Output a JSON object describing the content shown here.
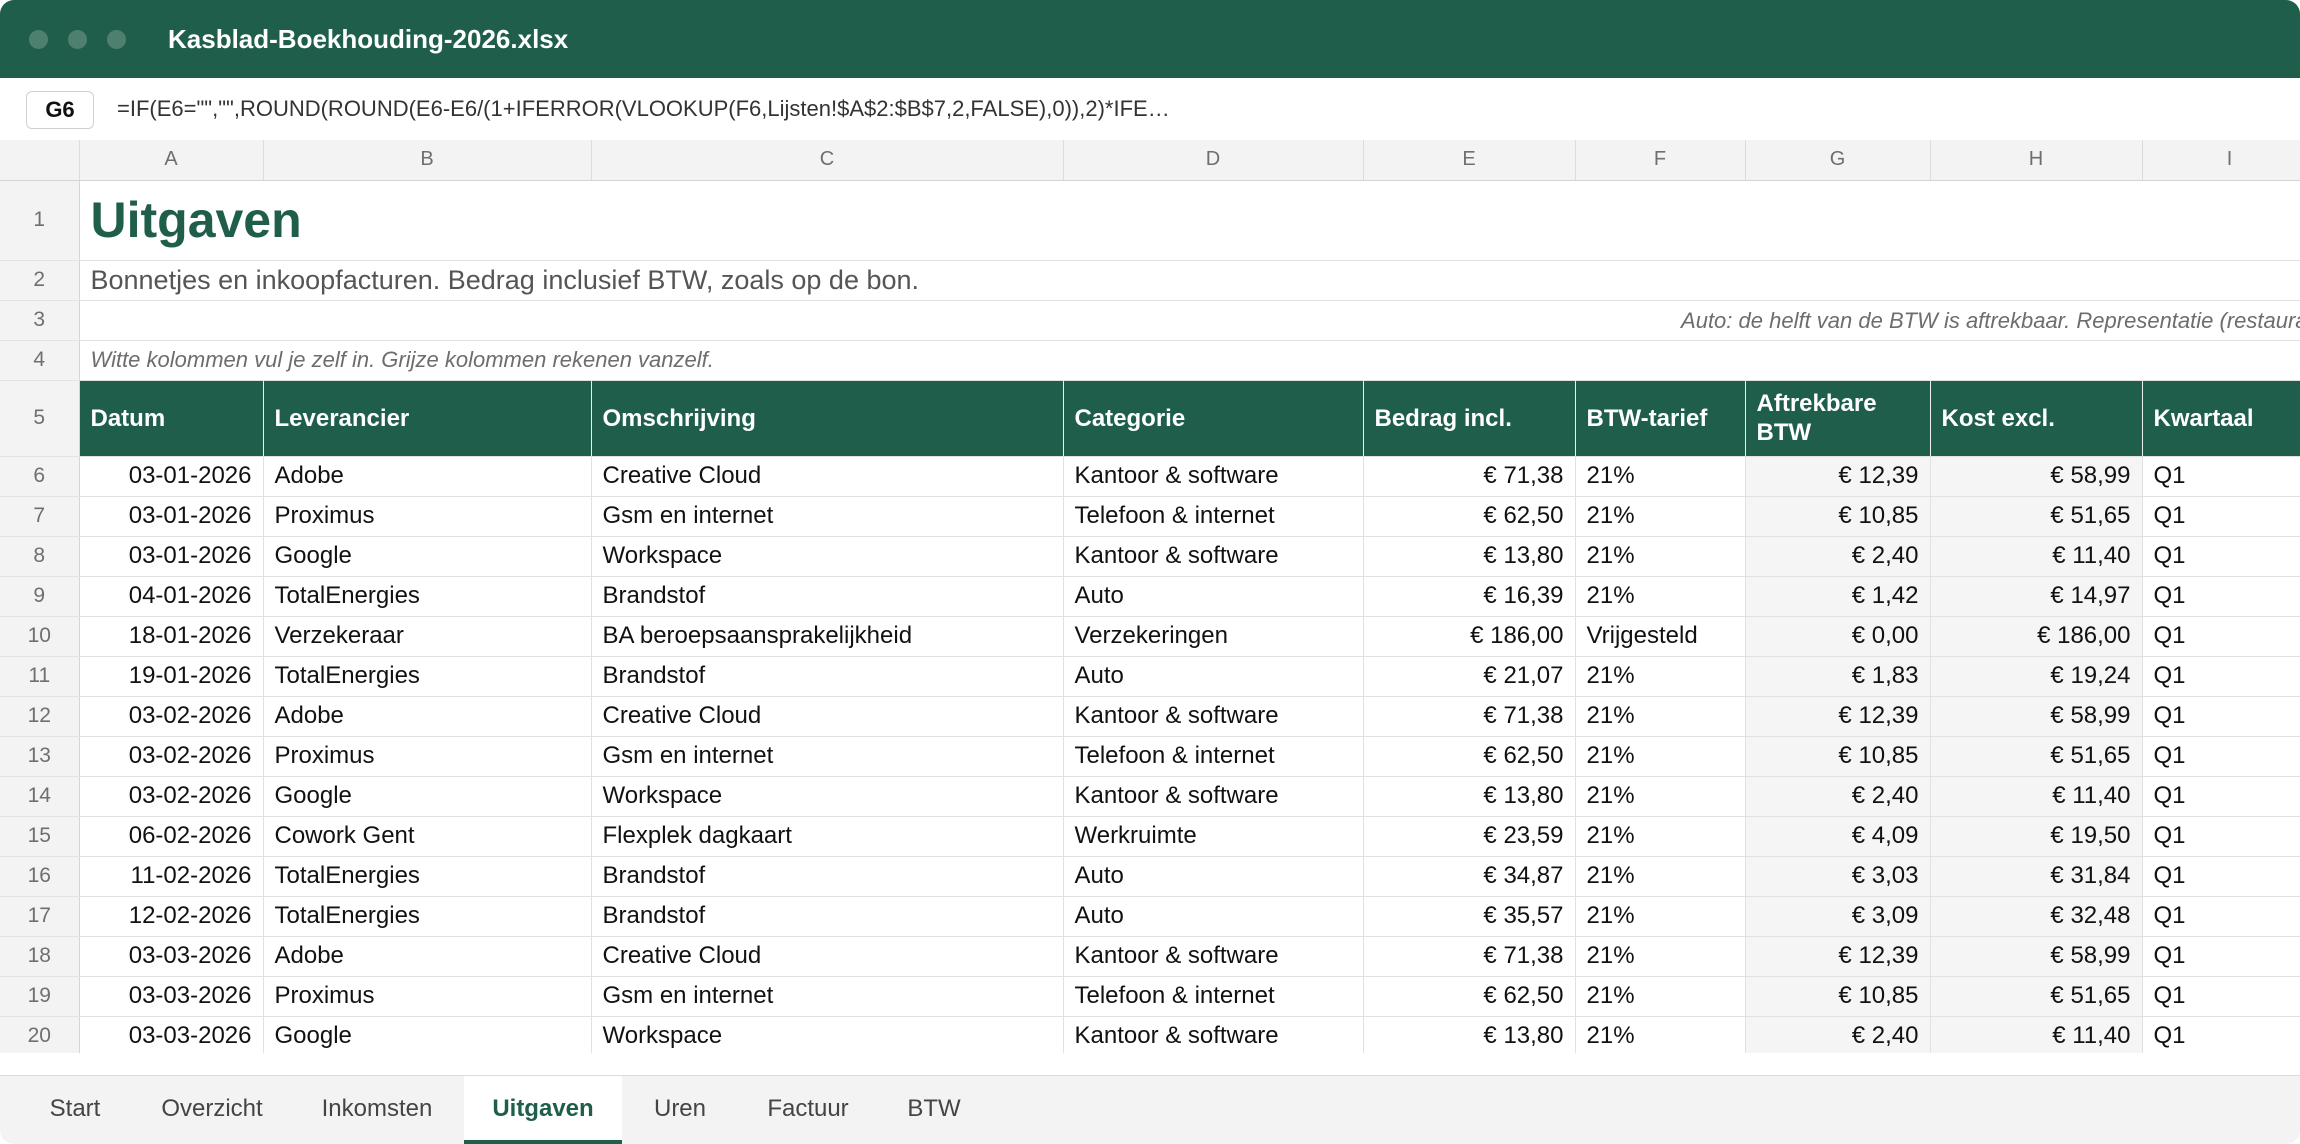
{
  "window": {
    "title": "Kasblad-Boekhouding-2026.xlsx"
  },
  "formula_bar": {
    "cell_ref": "G6",
    "formula": "=IF(E6=\"\",\"\",ROUND(ROUND(E6-E6/(1+IFERROR(VLOOKUP(F6,Lijsten!$A$2:$B$7,2,FALSE),0)),2)*IFE…"
  },
  "columns": [
    "A",
    "B",
    "C",
    "D",
    "E",
    "F",
    "G",
    "H",
    "I"
  ],
  "sheet": {
    "title": "Uitgaven",
    "subtitle": "Bonnetjes en inkoopfacturen. Bedrag inclusief BTW, zoals op de bon.",
    "note_auto": "Auto: de helft van de BTW is aftrekbaar. Representatie (restaurant,",
    "note_fill": "Witte kolommen vul je zelf in. Grijze kolommen rekenen vanzelf.",
    "headers": [
      "Datum",
      "Leverancier",
      "Omschrijving",
      "Categorie",
      "Bedrag incl.",
      "BTW-tarief",
      "Aftrekbare BTW",
      "Kost excl.",
      "Kwartaal"
    ],
    "rows": [
      {
        "row": "6",
        "cells": [
          "03-01-2026",
          "Adobe",
          "Creative Cloud",
          "Kantoor & software",
          "€ 71,38",
          "21%",
          "€ 12,39",
          "€ 58,99",
          "Q1"
        ]
      },
      {
        "row": "7",
        "cells": [
          "03-01-2026",
          "Proximus",
          "Gsm en internet",
          "Telefoon & internet",
          "€ 62,50",
          "21%",
          "€ 10,85",
          "€ 51,65",
          "Q1"
        ]
      },
      {
        "row": "8",
        "cells": [
          "03-01-2026",
          "Google",
          "Workspace",
          "Kantoor & software",
          "€ 13,80",
          "21%",
          "€ 2,40",
          "€ 11,40",
          "Q1"
        ]
      },
      {
        "row": "9",
        "cells": [
          "04-01-2026",
          "TotalEnergies",
          "Brandstof",
          "Auto",
          "€ 16,39",
          "21%",
          "€ 1,42",
          "€ 14,97",
          "Q1"
        ]
      },
      {
        "row": "10",
        "cells": [
          "18-01-2026",
          "Verzekeraar",
          "BA beroepsaansprakelijkheid",
          "Verzekeringen",
          "€ 186,00",
          "Vrijgesteld",
          "€ 0,00",
          "€ 186,00",
          "Q1"
        ]
      },
      {
        "row": "11",
        "cells": [
          "19-01-2026",
          "TotalEnergies",
          "Brandstof",
          "Auto",
          "€ 21,07",
          "21%",
          "€ 1,83",
          "€ 19,24",
          "Q1"
        ]
      },
      {
        "row": "12",
        "cells": [
          "03-02-2026",
          "Adobe",
          "Creative Cloud",
          "Kantoor & software",
          "€ 71,38",
          "21%",
          "€ 12,39",
          "€ 58,99",
          "Q1"
        ]
      },
      {
        "row": "13",
        "cells": [
          "03-02-2026",
          "Proximus",
          "Gsm en internet",
          "Telefoon & internet",
          "€ 62,50",
          "21%",
          "€ 10,85",
          "€ 51,65",
          "Q1"
        ]
      },
      {
        "row": "14",
        "cells": [
          "03-02-2026",
          "Google",
          "Workspace",
          "Kantoor & software",
          "€ 13,80",
          "21%",
          "€ 2,40",
          "€ 11,40",
          "Q1"
        ]
      },
      {
        "row": "15",
        "cells": [
          "06-02-2026",
          "Cowork Gent",
          "Flexplek dagkaart",
          "Werkruimte",
          "€ 23,59",
          "21%",
          "€ 4,09",
          "€ 19,50",
          "Q1"
        ]
      },
      {
        "row": "16",
        "cells": [
          "11-02-2026",
          "TotalEnergies",
          "Brandstof",
          "Auto",
          "€ 34,87",
          "21%",
          "€ 3,03",
          "€ 31,84",
          "Q1"
        ]
      },
      {
        "row": "17",
        "cells": [
          "12-02-2026",
          "TotalEnergies",
          "Brandstof",
          "Auto",
          "€ 35,57",
          "21%",
          "€ 3,09",
          "€ 32,48",
          "Q1"
        ]
      },
      {
        "row": "18",
        "cells": [
          "03-03-2026",
          "Adobe",
          "Creative Cloud",
          "Kantoor & software",
          "€ 71,38",
          "21%",
          "€ 12,39",
          "€ 58,99",
          "Q1"
        ]
      },
      {
        "row": "19",
        "cells": [
          "03-03-2026",
          "Proximus",
          "Gsm en internet",
          "Telefoon & internet",
          "€ 62,50",
          "21%",
          "€ 10,85",
          "€ 51,65",
          "Q1"
        ]
      },
      {
        "row": "20",
        "cells": [
          "03-03-2026",
          "Google",
          "Workspace",
          "Kantoor & software",
          "€ 13,80",
          "21%",
          "€ 2,40",
          "€ 11,40",
          "Q1"
        ]
      }
    ]
  },
  "tabs": [
    {
      "label": "Start"
    },
    {
      "label": "Overzicht"
    },
    {
      "label": "Inkomsten"
    },
    {
      "label": "Uitgaven",
      "active": true
    },
    {
      "label": "Uren"
    },
    {
      "label": "Factuur"
    },
    {
      "label": "BTW"
    }
  ],
  "colors": {
    "accent": "#1f5e4b",
    "header_text": "#ffffff",
    "computed_column_bg": "#f5f5f5",
    "row_header_bg": "#f3f3f3"
  }
}
